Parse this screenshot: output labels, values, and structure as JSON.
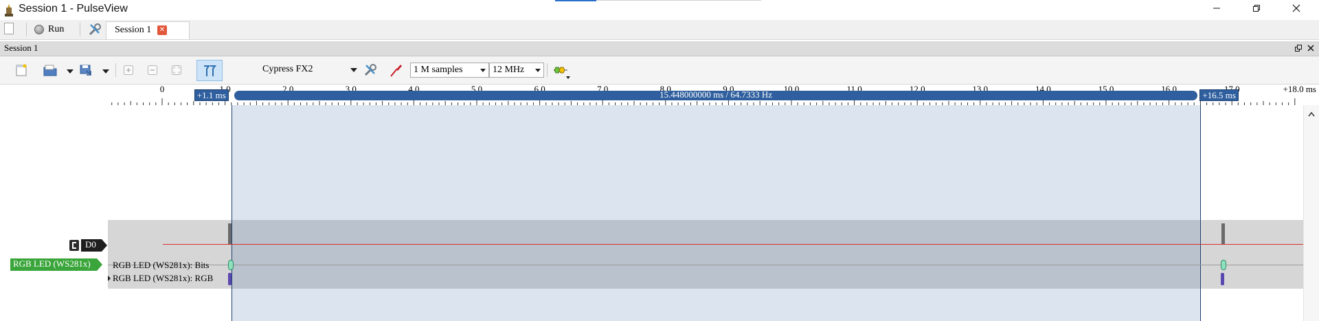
{
  "window": {
    "title": "Session 1 - PulseView",
    "app_icon": "pulseview-icon",
    "controls": [
      "minimize-icon",
      "restore-icon",
      "close-icon"
    ]
  },
  "main_toolbar": {
    "run_label": "Run",
    "session_tab_label": "Session 1"
  },
  "session": {
    "title": "Session 1"
  },
  "toolbar": {
    "device": "Cypress FX2",
    "sample_count": "1 M samples",
    "sample_rate": "12 MHz"
  },
  "ruler": {
    "ticks": [
      "0",
      "1.0",
      "2.0",
      "3.0",
      "4.0",
      "5.0",
      "6.0",
      "7.0",
      "8.0",
      "9.0",
      "10.0",
      "11.0",
      "12.0",
      "13.0",
      "14.0",
      "15.0",
      "16.0",
      "17.0"
    ],
    "end_label": "+18.0 ms",
    "cursor_left_label": "+1.1 ms",
    "cursor_right_label": "+16.5 ms",
    "cursor_span_label": "15.448000000 ms / 64.7333 Hz",
    "cursor_left_ms": 1.1,
    "cursor_right_ms": 16.5
  },
  "channels": {
    "logic": "D0",
    "decoder": "RGB LED (WS281x)",
    "rows": [
      "RGB LED (WS281x): Bits",
      "RGB LED (WS281x): RGB"
    ]
  },
  "colors": {
    "cursor_band": "#2f5f9e",
    "cursor_region": "#dbe4ef",
    "decoder_badge": "#3aa53a",
    "signal_line": "#d92f2f"
  }
}
